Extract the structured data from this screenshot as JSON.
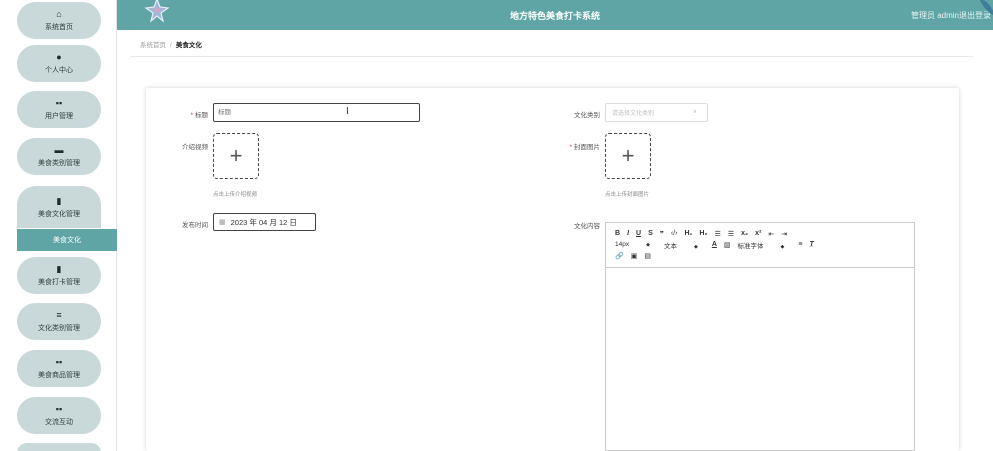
{
  "app": {
    "title": "地方特色美食打卡系统",
    "user_label": "管理员 admin",
    "logout_label": "退出登录"
  },
  "sidebar": {
    "items": [
      {
        "label": "系统首页",
        "icon": "home-icon",
        "glyph": "⌂"
      },
      {
        "label": "个人中心",
        "icon": "person-icon",
        "glyph": "●"
      },
      {
        "label": "用户管理",
        "icon": "grid-icon",
        "glyph": "▪▪"
      },
      {
        "label": "美食类别管理",
        "icon": "briefcase-icon",
        "glyph": "▬"
      },
      {
        "label": "美食文化管理",
        "icon": "document-icon",
        "glyph": "▮"
      },
      {
        "label": "美食打卡管理",
        "icon": "clipboard-icon",
        "glyph": "▮"
      },
      {
        "label": "文化类别管理",
        "icon": "sliders-icon",
        "glyph": "≡"
      },
      {
        "label": "美食商品管理",
        "icon": "grid-icon",
        "glyph": "▪▪"
      },
      {
        "label": "交流互动",
        "icon": "grid-icon",
        "glyph": "▪▪"
      }
    ],
    "active_sub": "美食文化"
  },
  "breadcrumb": {
    "home": "系统首页",
    "separator": "/",
    "current": "美食文化"
  },
  "form": {
    "title_label": "标题",
    "title_placeholder": "标题",
    "category_label": "文化类别",
    "category_placeholder": "请选择文化类别",
    "video_label": "介绍视频",
    "video_hint": "点击上传介绍视频",
    "cover_label": "封面图片",
    "cover_hint": "点击上传封面图片",
    "publish_label": "发布时间",
    "publish_value": "2023 年 04 月 12 日",
    "content_label": "文化内容",
    "upload_plus": "+"
  },
  "editor": {
    "font_size": "14px",
    "text_style": "文本",
    "font_family": "标准字体"
  },
  "colors": {
    "accent": "#5fa5a5",
    "sidebar_pill": "#c9d9da",
    "required": "#e4393c"
  }
}
